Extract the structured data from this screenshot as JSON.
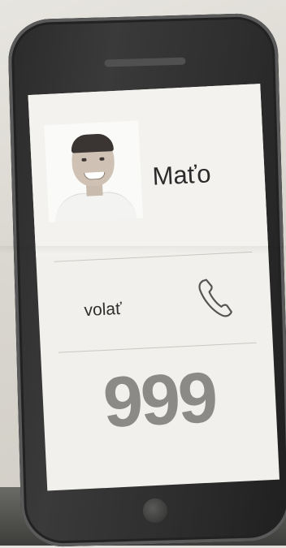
{
  "contact": {
    "name": "Maťo"
  },
  "actions": {
    "call_label": "volať",
    "call_icon": "phone-handset-icon"
  },
  "number": {
    "value": "999"
  }
}
